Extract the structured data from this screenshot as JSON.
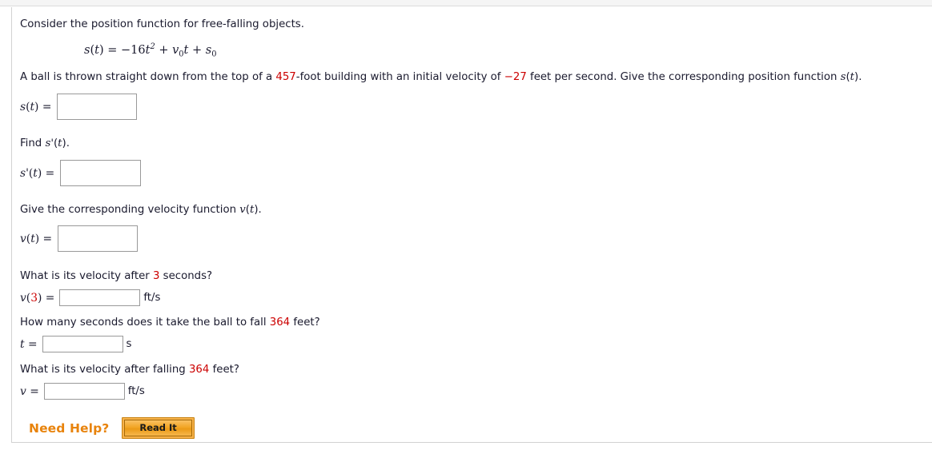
{
  "panel": {
    "intro": "Consider the position function for free-falling objects.",
    "formula": {
      "lhs_fn": "s",
      "lhs_var": "t",
      "coefficient": "−16",
      "term_var": "t",
      "exponent": "2",
      "v_symbol": "v",
      "v_subscript": "0",
      "v_mult_var": "t",
      "s_symbol": "s",
      "s_subscript": "0",
      "plus": "+",
      "equals": "=",
      "full_text": "s(t) = −16t² + v₀t + s₀"
    },
    "problem": {
      "part1": "A ball is thrown straight down from the top of a ",
      "height_value": "457",
      "part2": "-foot building with an initial velocity of ",
      "velocity_value": "−27",
      "part3": " feet per second. Give the corresponding position function ",
      "fn_s": "s",
      "fn_s_arg": "t",
      "part4": "."
    },
    "questions": [
      {
        "id": "position-function",
        "prompt_label": "s(t) =",
        "label_fn": "s",
        "label_arg": "t",
        "label_prime": "",
        "value": "",
        "placeholder": "",
        "unit": ""
      },
      {
        "id": "find-derivative",
        "prompt": "Find s'(t).",
        "prompt_prefix": "Find ",
        "prompt_fn": "s",
        "prompt_prime": "'",
        "prompt_arg": "t",
        "prompt_suffix": ".",
        "label_fn": "s",
        "label_prime": "'",
        "label_arg": "t",
        "value": "",
        "unit": ""
      },
      {
        "id": "velocity-function",
        "prompt_prefix": "Give the corresponding velocity function ",
        "prompt_fn": "v",
        "prompt_arg": "t",
        "prompt_suffix": ".",
        "label_fn": "v",
        "label_arg": "t",
        "value": "",
        "unit": ""
      },
      {
        "id": "velocity-at-3",
        "prompt_prefix": "What is its velocity after ",
        "prompt_value": "3",
        "prompt_suffix": " seconds?",
        "label_fn": "v",
        "label_arg": "3",
        "value": "",
        "unit": "ft/s"
      },
      {
        "id": "time-to-fall",
        "prompt_prefix": "How many seconds does it take the ball to fall ",
        "prompt_value": "364",
        "prompt_suffix": " feet?",
        "label_fn": "t",
        "value": "",
        "unit": "s"
      },
      {
        "id": "velocity-after-fall",
        "prompt_prefix": "What is its velocity after falling ",
        "prompt_value": "364",
        "prompt_suffix": " feet?",
        "label_fn": "v",
        "value": "",
        "unit": "ft/s"
      }
    ],
    "help": {
      "label": "Need Help?",
      "read_it_button": "Read It"
    },
    "colors": {
      "highlight": "#cc0000",
      "help_orange": "#e8830c",
      "button_fill": "#f2a626",
      "text": "#1a1a2e",
      "box_border": "#999999"
    }
  }
}
